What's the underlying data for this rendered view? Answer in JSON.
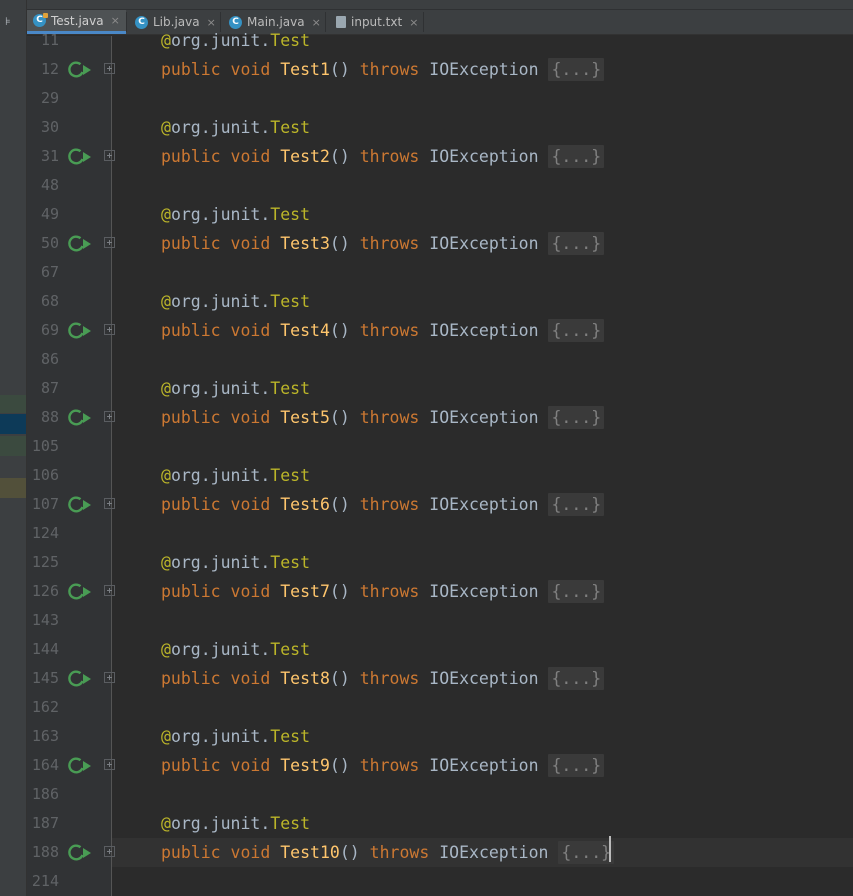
{
  "tabs": [
    {
      "label": "Test.java",
      "icon": "C",
      "active": true
    },
    {
      "label": "Lib.java",
      "icon": "C",
      "active": false
    },
    {
      "label": "Main.java",
      "icon": "C",
      "active": false
    },
    {
      "label": "input.txt",
      "icon": "text-file-icon",
      "active": false
    }
  ],
  "close_glyph": "×",
  "strip_glyph": "⊧",
  "colors": {
    "keyword": "#cc7832",
    "annotation": "#bbb529",
    "function": "#ffc66d",
    "text": "#a9b7c6",
    "run": "#499c54"
  },
  "code_tokens": {
    "at": "@",
    "annotation_pkg": "org.junit.",
    "annotation_name": "Test",
    "kw_public": "public",
    "kw_void": "void",
    "parens": "()",
    "kw_throws": "throws",
    "exception": "IOException",
    "folded": "{...}"
  },
  "first_partial_line": "11",
  "lines": [
    {
      "num": "12",
      "method": "Test1",
      "annotation_num": "11",
      "gap_num": "29"
    },
    {
      "num": "31",
      "method": "Test2",
      "annotation_num": "30",
      "gap_num": "48"
    },
    {
      "num": "50",
      "method": "Test3",
      "annotation_num": "49",
      "gap_num": "67"
    },
    {
      "num": "69",
      "method": "Test4",
      "annotation_num": "68",
      "gap_num": "86"
    },
    {
      "num": "88",
      "method": "Test5",
      "annotation_num": "87",
      "gap_num": "105"
    },
    {
      "num": "107",
      "method": "Test6",
      "annotation_num": "106",
      "gap_num": "124"
    },
    {
      "num": "126",
      "method": "Test7",
      "annotation_num": "125",
      "gap_num": "143"
    },
    {
      "num": "145",
      "method": "Test8",
      "annotation_num": "144",
      "gap_num": "162"
    },
    {
      "num": "164",
      "method": "Test9",
      "annotation_num": "163",
      "gap_num": "186"
    },
    {
      "num": "188",
      "method": "Test10",
      "annotation_num": "187",
      "gap_num": "214"
    }
  ]
}
